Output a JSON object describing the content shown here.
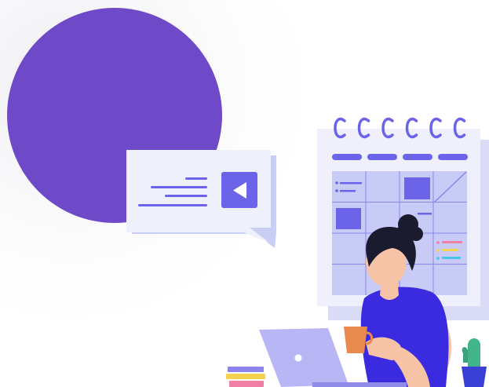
{
  "illustration": {
    "colors": {
      "purple_circle": "#6E4AC9",
      "bubble_fill": "#EEF0FC",
      "bubble_border": "#C9CEF4",
      "accent_indigo": "#6B63E8",
      "calendar_panel": "#EFF0FC",
      "calendar_shadow": "#DADCF6",
      "calendar_grid": "#C8CBF5",
      "shirt_blue": "#3B2BE0",
      "skin": "#F6C3A6",
      "hair": "#1B1B2F",
      "cup_orange": "#E8894E",
      "laptop_lavender": "#B8B6F5",
      "cactus_green": "#43B58A",
      "pot_blue": "#3A3FD6",
      "books_purple": "#8C83EE",
      "books_pink": "#F07EA5",
      "books_yellow": "#F5D34E",
      "legend_pink": "#F07EA5",
      "legend_yellow": "#F5D34E",
      "legend_cyan": "#45C7E8"
    },
    "icons": {
      "bubble_button": "play-left-icon",
      "calendar": "calendar-icon"
    }
  }
}
